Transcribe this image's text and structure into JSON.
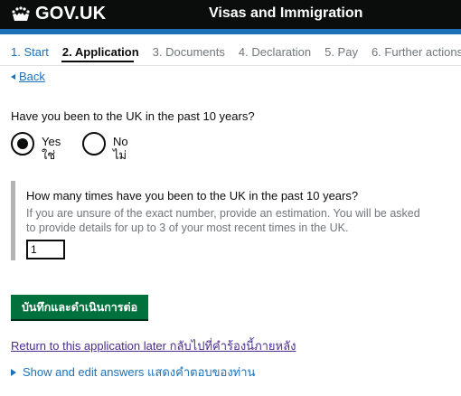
{
  "header": {
    "logo_text": "GOV.UK",
    "service_name": "Visas and Immigration",
    "colors": {
      "bar": "#0b0c0c",
      "stripe": "#1d70b8"
    }
  },
  "steps": [
    {
      "label": "1. Start"
    },
    {
      "label": "2. Application"
    },
    {
      "label": "3. Documents"
    },
    {
      "label": "4. Declaration"
    },
    {
      "label": "5. Pay"
    },
    {
      "label": "6. Further actions"
    }
  ],
  "back_link": "Back",
  "question": {
    "text": "Have you been to the UK in the past 10 years?",
    "options": [
      {
        "label": "Yes",
        "sublabel": "ใช่",
        "selected": true
      },
      {
        "label": "No",
        "sublabel": "ไม่",
        "selected": false
      }
    ]
  },
  "conditional": {
    "question": "How many times have you been to the UK in the past 10 years?",
    "hint": "If you are unsure of the exact number, provide an estimation. You will be asked to provide details for up to 3 of your most recent times in the UK.",
    "value": "1"
  },
  "submit_label": "บันทึกและดำเนินการต่อ",
  "return_link": "Return to this application later กลับไปที่คำร้องนี้ภายหลัง",
  "details_summary": "Show and edit answers แสดงคำตอบของท่าน",
  "colors": {
    "button": "#00703c",
    "link": "#1d70b8",
    "visited_link": "#4c2c92"
  }
}
